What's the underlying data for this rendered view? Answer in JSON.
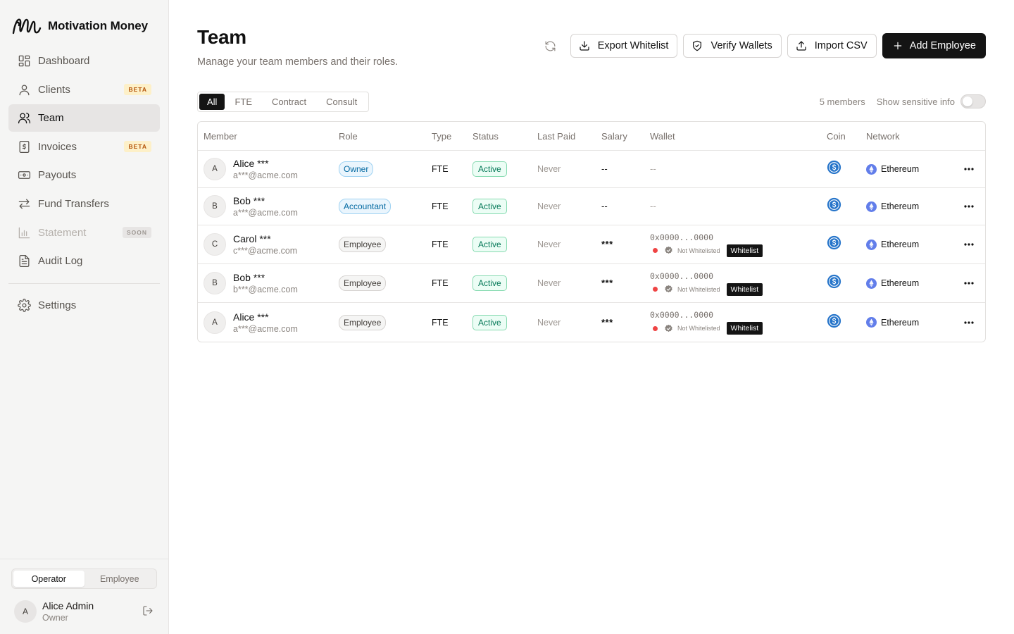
{
  "app": {
    "name": "Motivation Money"
  },
  "sidebar": {
    "items": [
      {
        "label": "Dashboard",
        "icon": "dashboard-icon"
      },
      {
        "label": "Clients",
        "icon": "user-icon",
        "badge": "BETA"
      },
      {
        "label": "Team",
        "icon": "users-icon",
        "active": true
      },
      {
        "label": "Invoices",
        "icon": "invoice-icon",
        "badge": "BETA"
      },
      {
        "label": "Payouts",
        "icon": "banknote-icon"
      },
      {
        "label": "Fund Transfers",
        "icon": "transfer-icon"
      },
      {
        "label": "Statement",
        "icon": "bar-chart-icon",
        "badge": "SOON",
        "disabled": true
      },
      {
        "label": "Audit Log",
        "icon": "file-text-icon"
      }
    ],
    "settings_label": "Settings",
    "mode": {
      "options": [
        "Operator",
        "Employee"
      ],
      "selected": "Operator"
    },
    "user": {
      "initial": "A",
      "name": "Alice Admin",
      "role": "Owner"
    }
  },
  "page": {
    "title": "Team",
    "subtitle": "Manage your team members and their roles."
  },
  "toolbar": {
    "export_label": "Export Whitelist",
    "verify_label": "Verify Wallets",
    "import_label": "Import CSV",
    "add_label": "Add Employee"
  },
  "filters": {
    "tabs": [
      "All",
      "FTE",
      "Contract",
      "Consult"
    ],
    "selected": "All"
  },
  "meta": {
    "count": "5 members",
    "sensitive_label": "Show sensitive info",
    "sensitive_on": false
  },
  "table": {
    "columns": [
      "Member",
      "Role",
      "Type",
      "Status",
      "Last Paid",
      "Salary",
      "Wallet",
      "Coin",
      "Network"
    ],
    "rows": [
      {
        "initial": "A",
        "name": "Alice ***",
        "email": "a***@acme.com",
        "role": "Owner",
        "type": "FTE",
        "status": "Active",
        "last_paid": "Never",
        "salary": "--",
        "wallet": "--",
        "network": "Ethereum"
      },
      {
        "initial": "B",
        "name": "Bob ***",
        "email": "a***@acme.com",
        "role": "Accountant",
        "type": "FTE",
        "status": "Active",
        "last_paid": "Never",
        "salary": "--",
        "wallet": "--",
        "network": "Ethereum"
      },
      {
        "initial": "C",
        "name": "Carol ***",
        "email": "c***@acme.com",
        "role": "Employee",
        "type": "FTE",
        "status": "Active",
        "last_paid": "Never",
        "salary": "***",
        "wallet": "0x0000...0000",
        "wallet_status": "Not Whitelisted",
        "wallet_action": "Whitelist",
        "network": "Ethereum"
      },
      {
        "initial": "B",
        "name": "Bob ***",
        "email": "b***@acme.com",
        "role": "Employee",
        "type": "FTE",
        "status": "Active",
        "last_paid": "Never",
        "salary": "***",
        "wallet": "0x0000...0000",
        "wallet_status": "Not Whitelisted",
        "wallet_action": "Whitelist",
        "network": "Ethereum"
      },
      {
        "initial": "A",
        "name": "Alice ***",
        "email": "a***@acme.com",
        "role": "Employee",
        "type": "FTE",
        "status": "Active",
        "last_paid": "Never",
        "salary": "***",
        "wallet": "0x0000...0000",
        "wallet_status": "Not Whitelisted",
        "wallet_action": "Whitelist",
        "network": "Ethereum"
      }
    ]
  },
  "colors": {
    "primary": "#141414",
    "beta_badge": "#b45309",
    "active_status": "#047857",
    "role_badge": "#0369a1",
    "not_whitelisted_dot": "#ef4444",
    "usdc": "#2775ca",
    "ethereum": "#627eea"
  }
}
